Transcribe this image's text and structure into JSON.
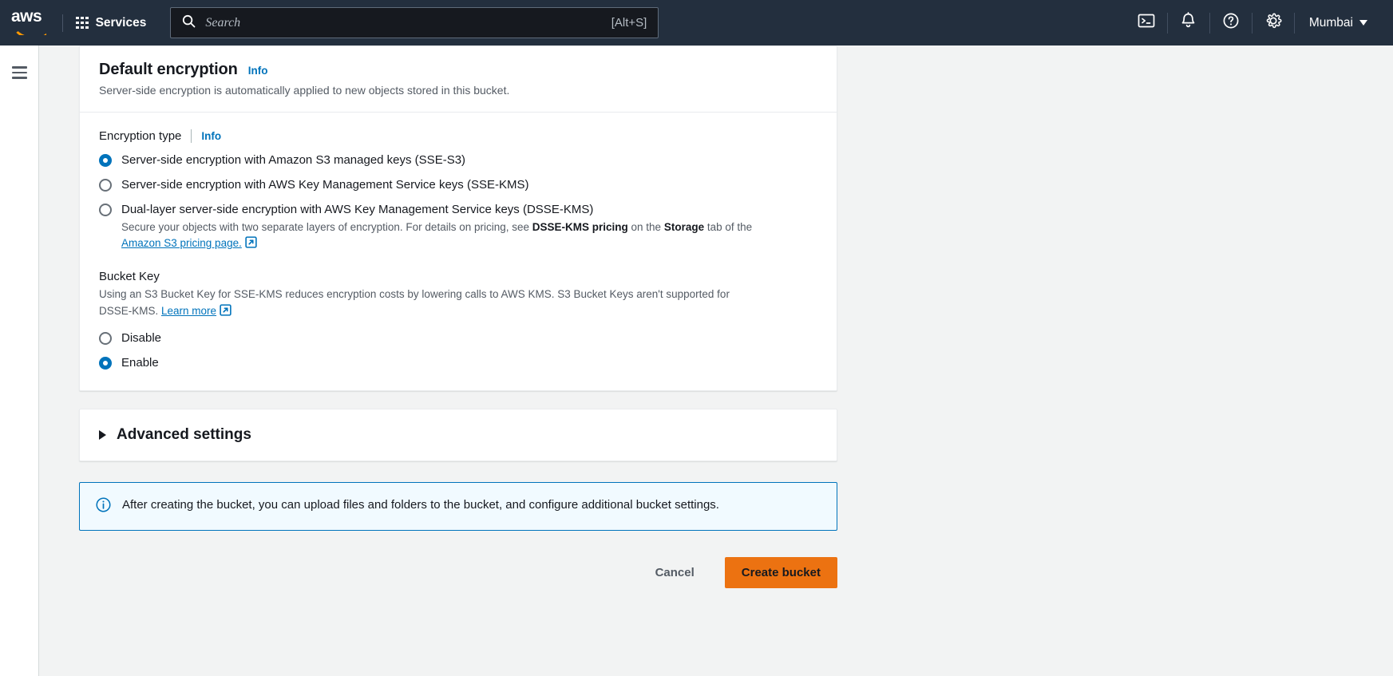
{
  "topnav": {
    "logo_text": "aws",
    "services_label": "Services",
    "search": {
      "placeholder": "Search",
      "shortcut": "[Alt+S]"
    },
    "icons": [
      "cloudshell-terminal-icon",
      "notifications-bell-icon",
      "help-question-icon",
      "settings-gear-icon"
    ],
    "region_label": "Mumbai"
  },
  "sidebar": {
    "menu_toggle": "hamburger-menu-icon"
  },
  "encryption_card": {
    "title": "Default encryption",
    "info_label": "Info",
    "subtitle": "Server-side encryption is automatically applied to new objects stored in this bucket.",
    "encryption_type": {
      "label": "Encryption type",
      "info_label": "Info",
      "options": [
        {
          "label": "Server-side encryption with Amazon S3 managed keys (SSE-S3)",
          "selected": true
        },
        {
          "label": "Server-side encryption with AWS Key Management Service keys (SSE-KMS)",
          "selected": false
        },
        {
          "label": "Dual-layer server-side encryption with AWS Key Management Service keys (DSSE-KMS)",
          "selected": false,
          "description_part1": "Secure your objects with two separate layers of encryption. For details on pricing, see ",
          "description_bold1": "DSSE-KMS pricing",
          "description_part2": " on the ",
          "description_bold2": "Storage",
          "description_part3": " tab of the ",
          "description_link": "Amazon S3 pricing page."
        }
      ]
    },
    "bucket_key": {
      "label": "Bucket Key",
      "description_part1": "Using an S3 Bucket Key for SSE-KMS reduces encryption costs by lowering calls to AWS KMS. S3 Bucket Keys aren't supported for DSSE-KMS. ",
      "description_link": "Learn more",
      "options": [
        {
          "label": "Disable",
          "selected": false
        },
        {
          "label": "Enable",
          "selected": true
        }
      ]
    }
  },
  "advanced_settings": {
    "title": "Advanced settings",
    "expanded": false
  },
  "alert": {
    "icon": "info-circle-icon",
    "text": "After creating the bucket, you can upload files and folders to the bucket, and configure additional bucket settings."
  },
  "actions": {
    "cancel_label": "Cancel",
    "create_label": "Create bucket"
  },
  "colors": {
    "nav_background": "#232f3e",
    "accent_blue": "#0073bb",
    "primary_button": "#ec7211",
    "page_background": "#f2f3f3",
    "alert_background": "#f1faff"
  }
}
